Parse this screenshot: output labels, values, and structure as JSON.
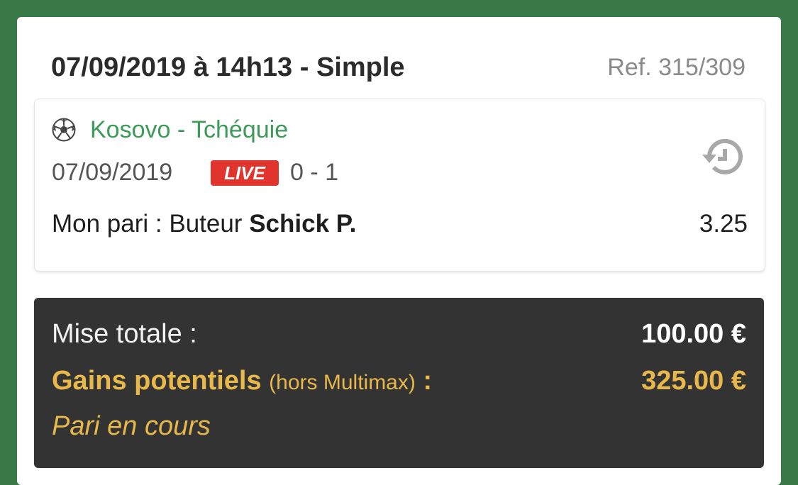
{
  "bet": {
    "title": "07/09/2019 à 14h13 - Simple",
    "ref": "Ref. 315/309"
  },
  "event": {
    "sport_icon": "soccer-ball-icon",
    "match": "Kosovo - Tchéquie",
    "date": "07/09/2019",
    "live_badge": "LIVE",
    "score": "0 - 1",
    "history_icon": "history-icon",
    "bet_prefix": "Mon pari : Buteur ",
    "bet_player": "Schick P.",
    "odds": "3.25"
  },
  "summary": {
    "stake_label": "Mise totale :",
    "stake_value": "100.00 €",
    "gain_label": "Gains potentiels ",
    "gain_sub": "(hors Multimax)",
    "gain_colon": " :",
    "gain_value": "325.00 €",
    "status": "Pari en cours"
  },
  "colors": {
    "background": "#3a7a48",
    "match_green": "#3d9a58",
    "live_red": "#e0342c",
    "gain_gold": "#e8b84a",
    "summary_bg": "#333333"
  }
}
